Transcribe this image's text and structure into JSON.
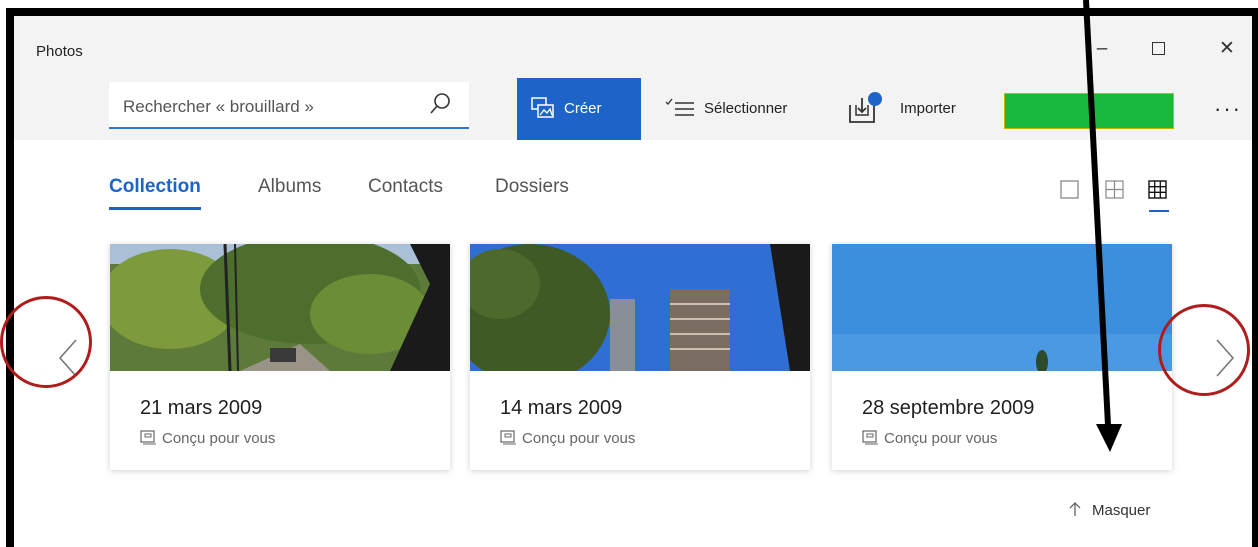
{
  "window": {
    "title": "Photos",
    "minimize_glyph": "–",
    "close_glyph": "✕"
  },
  "search": {
    "placeholder": "Rechercher « brouillard »"
  },
  "toolbar": {
    "create_label": "Créer",
    "select_label": "Sélectionner",
    "import_label": "Importer",
    "more_label": "···"
  },
  "tabs": [
    {
      "label": "Collection",
      "active": true
    },
    {
      "label": "Albums",
      "active": false
    },
    {
      "label": "Contacts",
      "active": false
    },
    {
      "label": "Dossiers",
      "active": false
    }
  ],
  "cards": [
    {
      "date": "21 mars 2009",
      "subtitle": "Conçu pour vous"
    },
    {
      "date": "14 mars 2009",
      "subtitle": "Conçu pour vous"
    },
    {
      "date": "28 septembre 2009",
      "subtitle": "Conçu pour vous"
    }
  ],
  "hide_label": "Masquer",
  "colors": {
    "accent": "#1e64c8",
    "annotation_circle": "#b01c1c",
    "account_placeholder": "#18b83c"
  },
  "icons": [
    "search-icon",
    "create-icon",
    "select-list-icon",
    "import-icon",
    "chevron-left-icon",
    "chevron-right-icon",
    "arrow-up-icon",
    "designed-for-you-icon"
  ]
}
